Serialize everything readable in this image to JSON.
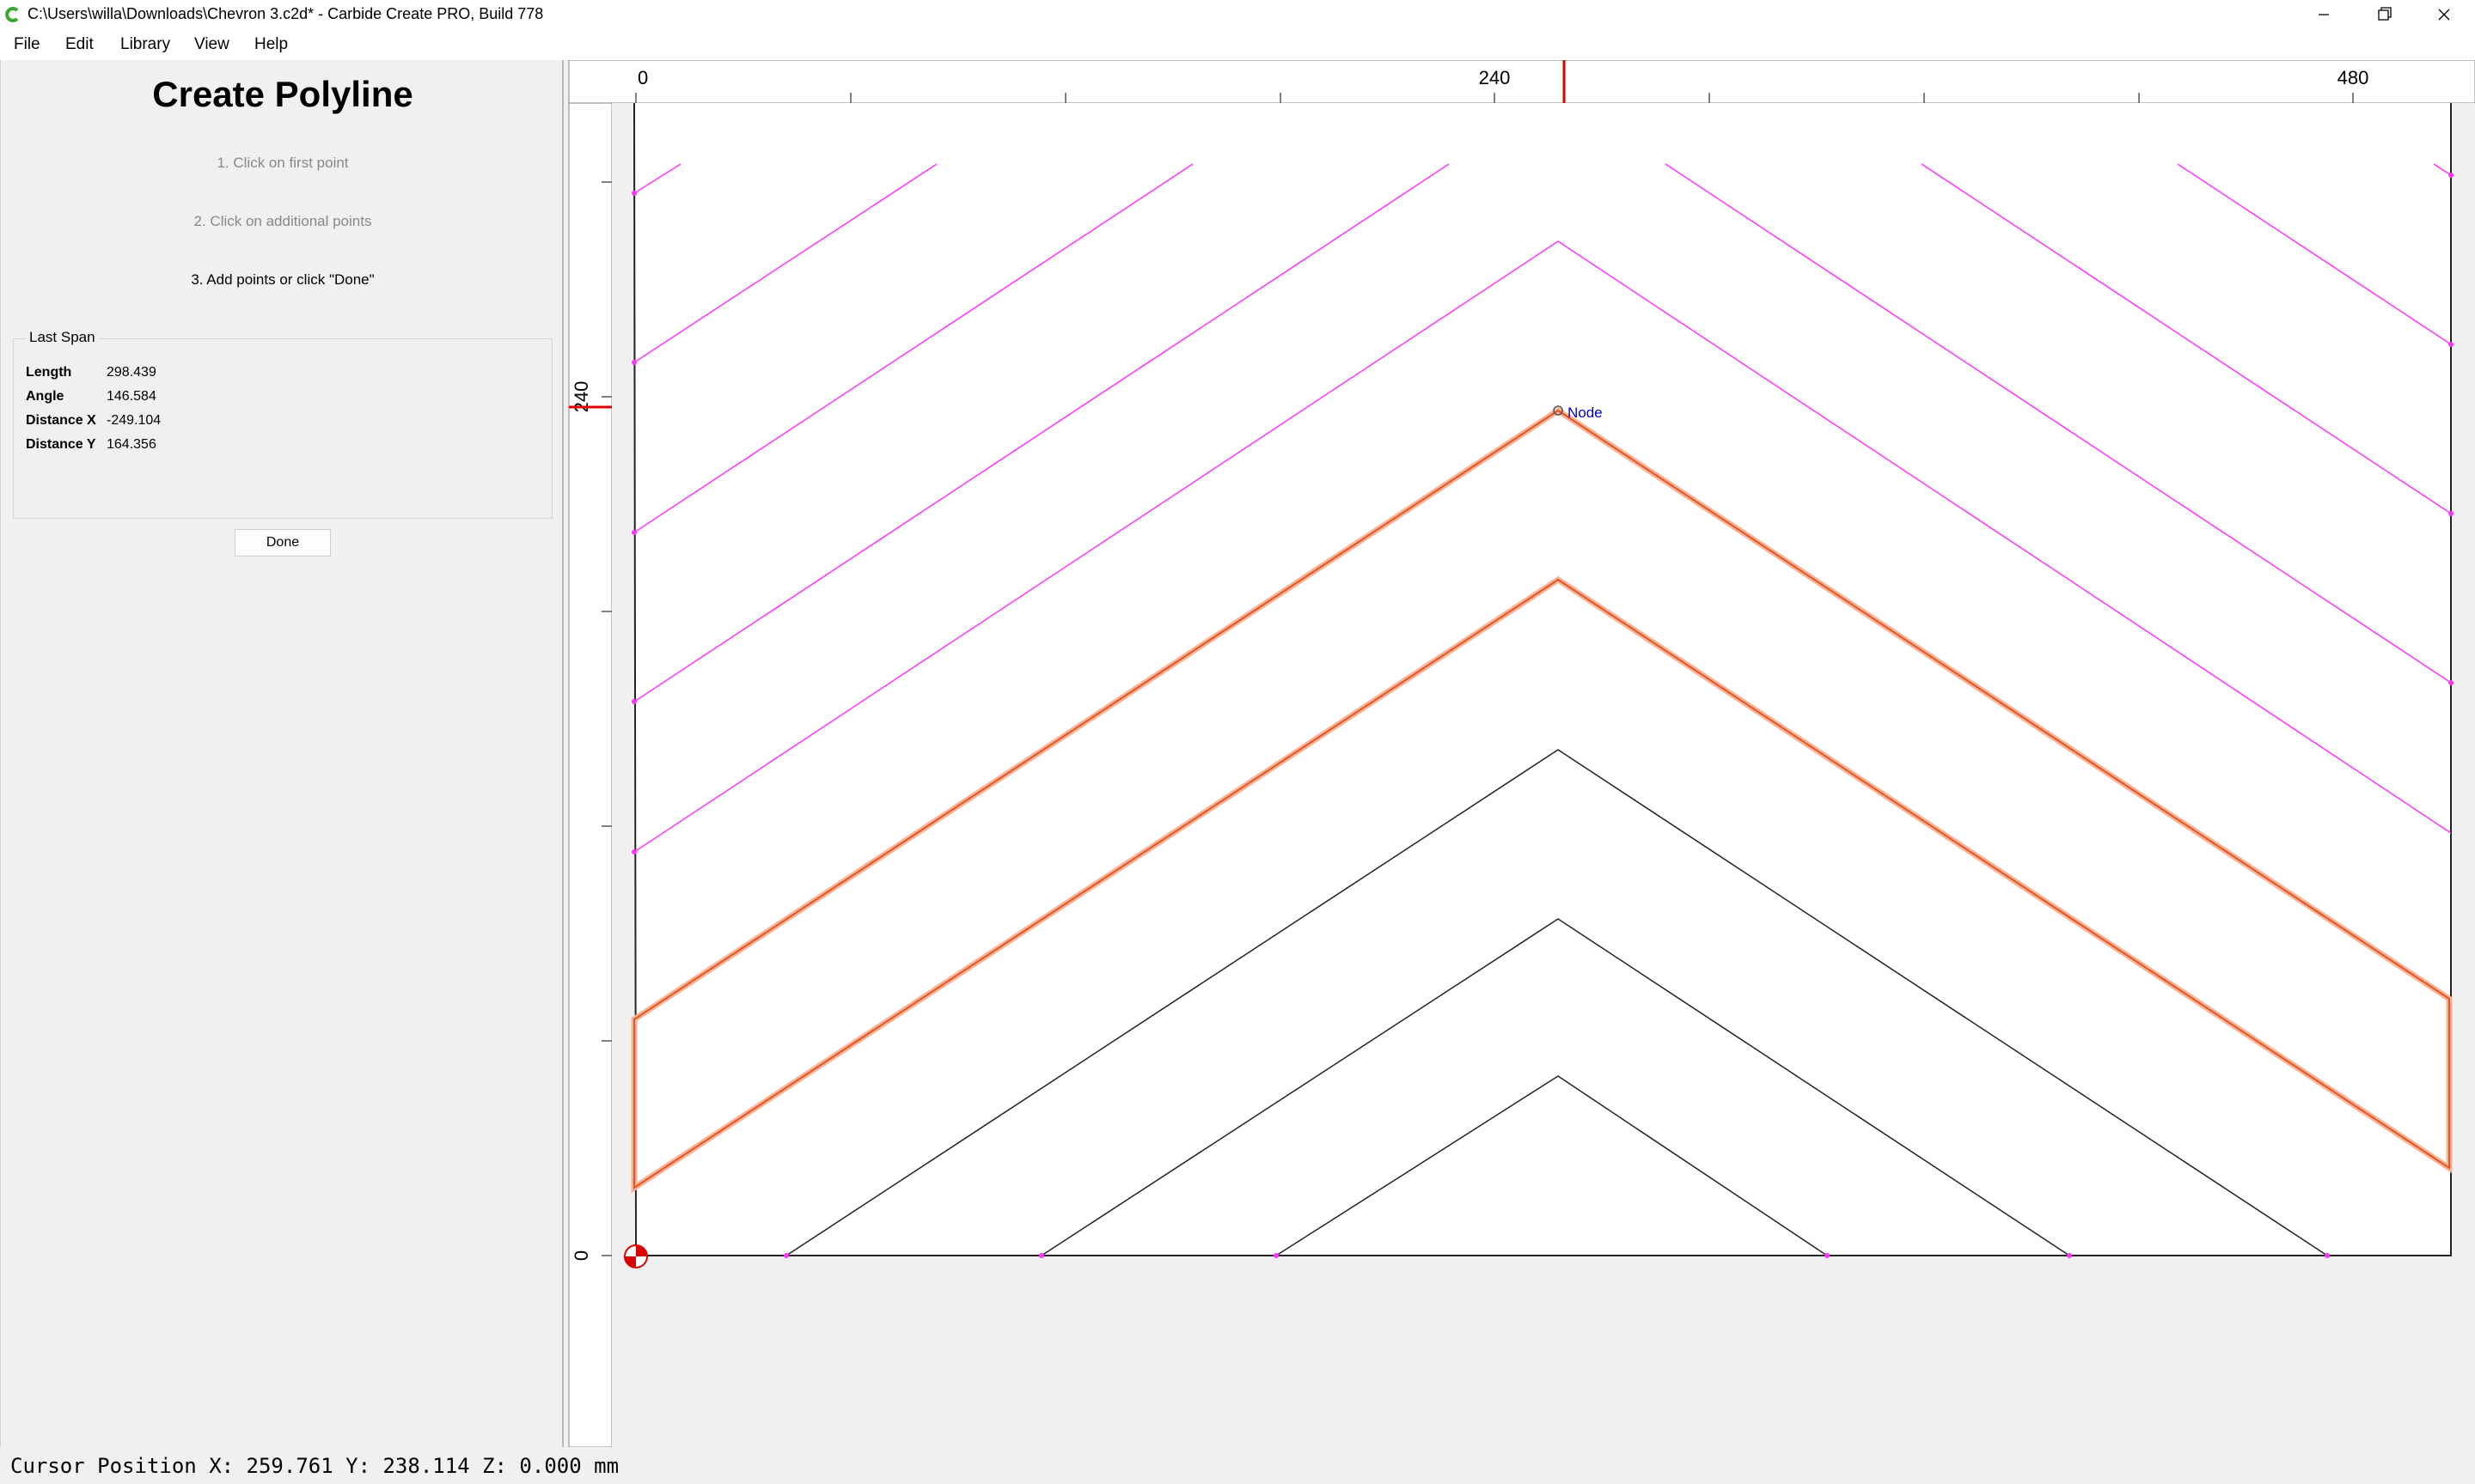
{
  "window": {
    "title": "C:\\Users\\willa\\Downloads\\Chevron 3.c2d* - Carbide Create PRO, Build 778",
    "app_icon": "carbide-c-icon",
    "controls": [
      "minimize-icon",
      "restore-icon",
      "close-icon"
    ]
  },
  "menu": {
    "items": [
      "File",
      "Edit",
      "Library",
      "View",
      "Help"
    ]
  },
  "panel": {
    "title": "Create Polyline",
    "steps": [
      "1. Click on first point",
      "2. Click on additional points",
      "3. Add points or click \"Done\""
    ],
    "last_span": {
      "title": "Last Span",
      "rows": [
        {
          "label": "Length",
          "value": "298.439"
        },
        {
          "label": "Angle",
          "value": "146.584"
        },
        {
          "label": "Distance X",
          "value": "-249.104"
        },
        {
          "label": "Distance Y",
          "value": "164.356"
        }
      ]
    },
    "done_label": "Done"
  },
  "canvas": {
    "ruler_top_labels": [
      "0",
      "240",
      "480"
    ],
    "ruler_left_labels": [
      "240",
      "0"
    ],
    "node_label": "Node",
    "colors": {
      "selected": "#e8541e",
      "toolpath": "#ff33ff",
      "geometry": "#222222",
      "cursor_marker": "#dd0000",
      "node_label": "#0000cc"
    }
  },
  "status": {
    "cursor_position": "Cursor Position X: 259.761 Y: 238.114 Z: 0.000 mm"
  }
}
